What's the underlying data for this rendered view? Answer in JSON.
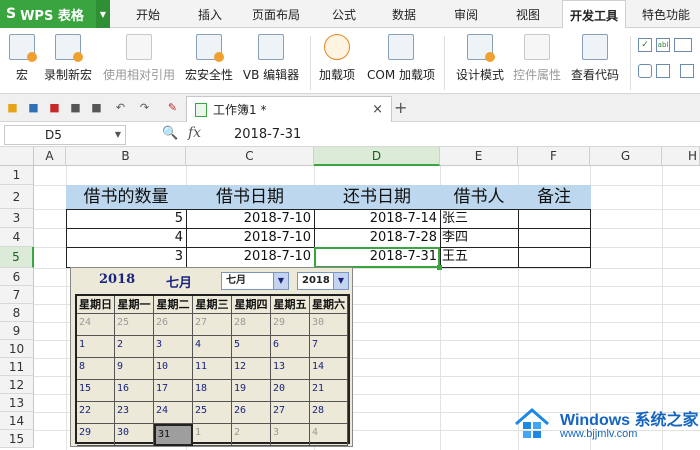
{
  "menu": {
    "app_label": "WPS 表格",
    "tabs": [
      "开始",
      "插入",
      "页面布局",
      "公式",
      "数据",
      "审阅",
      "视图",
      "开发工具",
      "特色功能"
    ],
    "active_tab": "开发工具"
  },
  "ribbon": {
    "buttons": [
      {
        "label": "宏",
        "icon": "macro-icon"
      },
      {
        "label": "录制新宏",
        "icon": "record-macro-icon"
      },
      {
        "label": "使用相对引用",
        "icon": "relative-ref-icon"
      },
      {
        "label": "宏安全性",
        "icon": "macro-security-icon"
      },
      {
        "label": "VB 编辑器",
        "icon": "vb-editor-icon"
      },
      {
        "label": "加载项",
        "icon": "addins-gear-icon"
      },
      {
        "label": "COM 加载项",
        "icon": "com-addins-icon"
      },
      {
        "label": "设计模式",
        "icon": "design-mode-icon"
      },
      {
        "label": "控件属性",
        "icon": "control-properties-icon"
      },
      {
        "label": "查看代码",
        "icon": "view-code-icon"
      }
    ]
  },
  "document_tab": {
    "label": "工作簿1 *"
  },
  "formula_bar": {
    "name_box": "D5",
    "fx": "fx",
    "value": "2018-7-31"
  },
  "columns": [
    "A",
    "B",
    "C",
    "D",
    "E",
    "F",
    "G",
    "H"
  ],
  "rows": [
    "1",
    "2",
    "3",
    "4",
    "5",
    "6",
    "7",
    "8",
    "9",
    "10",
    "11",
    "12",
    "13",
    "14",
    "15"
  ],
  "table": {
    "headers": [
      "借书的数量",
      "借书日期",
      "还书日期",
      "借书人",
      "备注"
    ],
    "records": [
      {
        "qty": "5",
        "borrow": "2018-7-10",
        "return": "2018-7-14",
        "person": "张三"
      },
      {
        "qty": "4",
        "borrow": "2018-7-10",
        "return": "2018-7-28",
        "person": "李四"
      },
      {
        "qty": "3",
        "borrow": "2018-7-10",
        "return": "2018-7-31",
        "person": "王五"
      }
    ]
  },
  "calendar": {
    "year": "2018",
    "month": "七月",
    "month_select": "七月",
    "year_select": "2018",
    "weekdays": [
      "星期日",
      "星期一",
      "星期二",
      "星期三",
      "星期四",
      "星期五",
      "星期六"
    ],
    "weeks": [
      [
        "24",
        "25",
        "26",
        "27",
        "28",
        "29",
        "30"
      ],
      [
        "1",
        "2",
        "3",
        "4",
        "5",
        "6",
        "7"
      ],
      [
        "8",
        "9",
        "10",
        "11",
        "12",
        "13",
        "14"
      ],
      [
        "15",
        "16",
        "17",
        "18",
        "19",
        "20",
        "21"
      ],
      [
        "22",
        "23",
        "24",
        "25",
        "26",
        "27",
        "28"
      ],
      [
        "29",
        "30",
        "31",
        "1",
        "2",
        "3",
        "4"
      ]
    ],
    "selected_day": "31"
  },
  "watermark": {
    "brand": "Windows 系统之家",
    "site": "www.bjjmlv.com"
  },
  "colors": {
    "accent": "#3aa53f",
    "header_fill": "#bdd7ee",
    "calendar_bg": "#ece9d8"
  }
}
